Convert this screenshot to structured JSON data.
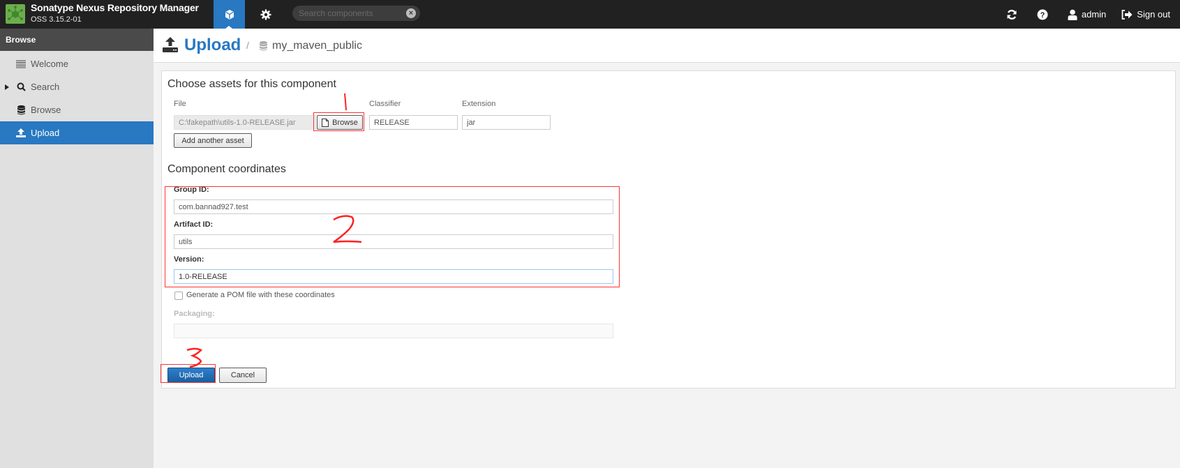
{
  "app": {
    "title": "Sonatype Nexus Repository Manager",
    "version": "OSS 3.15.2-01",
    "logo_color": "#6cad4c"
  },
  "topbar": {
    "tabs": [
      {
        "name": "browse",
        "icon": "cube-icon",
        "active": true
      },
      {
        "name": "administration",
        "icon": "gear-icon",
        "active": false
      }
    ],
    "search": {
      "placeholder": "Search components",
      "value": ""
    },
    "actions": [
      {
        "label": "",
        "icon": "refresh-icon"
      },
      {
        "label": "",
        "icon": "help-icon"
      },
      {
        "label": "admin",
        "icon": "user-icon"
      },
      {
        "label": "Sign out",
        "icon": "sign-out-icon"
      }
    ]
  },
  "sidebar": {
    "header": "Browse",
    "items": [
      {
        "label": "Welcome",
        "icon": "list-icon",
        "active": false,
        "expandable": false
      },
      {
        "label": "Search",
        "icon": "search-icon",
        "active": false,
        "expandable": true
      },
      {
        "label": "Browse",
        "icon": "database-icon",
        "active": false,
        "expandable": false
      },
      {
        "label": "Upload",
        "icon": "upload-icon",
        "active": true,
        "expandable": false
      }
    ]
  },
  "page_header": {
    "title": "Upload",
    "separator": "/",
    "repository": "my_maven_public"
  },
  "assets": {
    "title": "Choose assets for this component",
    "file_label": "File",
    "file_value": "C:\\fakepath\\utils-1.0-RELEASE.jar",
    "browse_label": "Browse",
    "classifier_label": "Classifier",
    "classifier_value": "RELEASE",
    "extension_label": "Extension",
    "extension_value": "jar",
    "add_asset_label": "Add another asset"
  },
  "coordinates": {
    "title": "Component coordinates",
    "group_label": "Group ID:",
    "group_value": "com.bannad927.test",
    "artifact_label": "Artifact ID:",
    "artifact_value": "utils",
    "version_label": "Version:",
    "version_value": "1.0-RELEASE",
    "generate_pom_label": "Generate a POM file with these coordinates",
    "generate_pom_checked": false,
    "packaging_label": "Packaging:",
    "packaging_value": ""
  },
  "actions": {
    "upload_label": "Upload",
    "cancel_label": "Cancel"
  },
  "annotations": {
    "color": "#ff3333",
    "marks": [
      "1",
      "2",
      "3"
    ]
  }
}
